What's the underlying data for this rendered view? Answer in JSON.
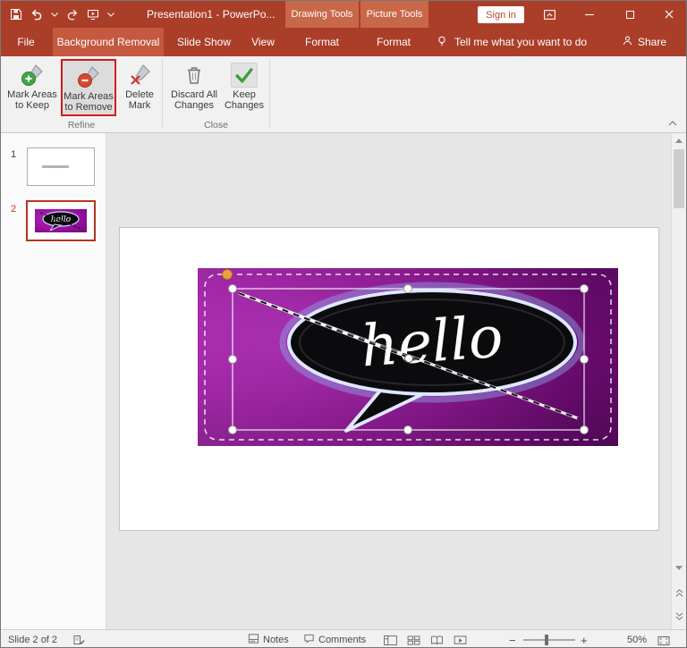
{
  "colors": {
    "titlebar": "#AB3E28",
    "contextual-header": "#C96749",
    "active-tab": "#C4593F",
    "annotation-red": "#CF1D1D",
    "selection-border-red": "#B0361F",
    "ribbon-bg": "#F1F1F1",
    "canvas-bg": "#E6E6E6",
    "picture-magenta": "#99119F",
    "keep-green": "#45A649",
    "remove-red": "#D6492F"
  },
  "titlebar": {
    "title": "Presentation1 - PowerPo...",
    "drawing_tools": "Drawing Tools",
    "picture_tools": "Picture Tools",
    "sign_in": "Sign in"
  },
  "tabs": {
    "file": "File",
    "background_removal": "Background Removal",
    "slide_show": "Slide Show",
    "view": "View",
    "format_drawing": "Format",
    "format_picture": "Format",
    "tell_me": "Tell me what you want to do",
    "share": "Share"
  },
  "ribbon": {
    "mark_keep": {
      "line1": "Mark Areas",
      "line2": "to Keep"
    },
    "mark_remove": {
      "line1": "Mark Areas",
      "line2": "to Remove"
    },
    "delete_mark": {
      "line1": "Delete",
      "line2": "Mark"
    },
    "discard": {
      "line1": "Discard All",
      "line2": "Changes"
    },
    "keep_changes": {
      "line1": "Keep",
      "line2": "Changes"
    },
    "group_refine": "Refine",
    "group_close": "Close"
  },
  "slides": {
    "slide1_number": "1",
    "slide2_number": "2"
  },
  "picture": {
    "text": "hello"
  },
  "statusbar": {
    "slide_indicator": "Slide 2 of 2",
    "notes": "Notes",
    "comments": "Comments",
    "zoom_out": "−",
    "zoom_in": "+",
    "zoom": "50%"
  }
}
